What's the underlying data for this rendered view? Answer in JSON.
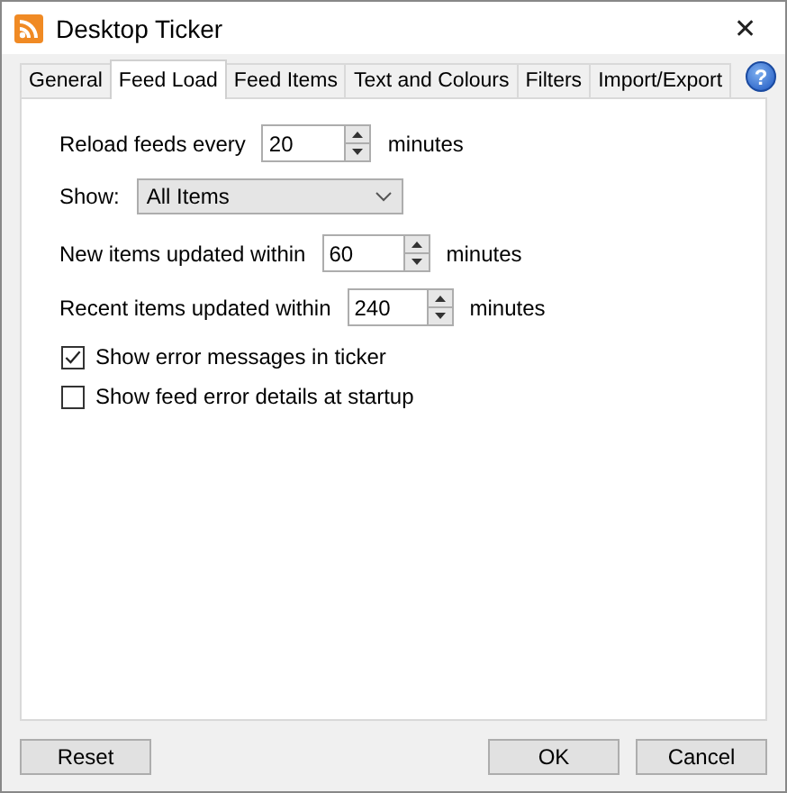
{
  "window": {
    "title": "Desktop Ticker",
    "close": "✕"
  },
  "tabs": [
    {
      "label": "General",
      "selected": false
    },
    {
      "label": "Feed Load",
      "selected": true
    },
    {
      "label": "Feed Items",
      "selected": false
    },
    {
      "label": "Text and Colours",
      "selected": false
    },
    {
      "label": "Filters",
      "selected": false
    },
    {
      "label": "Import/Export",
      "selected": false
    }
  ],
  "help": "?",
  "settings": [
    {
      "kind": "spinner",
      "label": "Reload feeds every",
      "value": "20",
      "unit": "minutes"
    },
    {
      "kind": "dropdown",
      "label": "Show:",
      "value": "All Items"
    },
    {
      "kind": "spinner",
      "label": "New items updated within",
      "value": "60",
      "unit": "minutes"
    },
    {
      "kind": "spinner",
      "label": "Recent items updated within",
      "value": "240",
      "unit": "minutes"
    },
    {
      "kind": "checkbox",
      "label": "Show error messages in ticker",
      "checked": true
    },
    {
      "kind": "checkbox",
      "label": "Show feed error details at startup",
      "checked": false
    }
  ],
  "buttons": {
    "left": [
      "Reset"
    ],
    "right": [
      "OK",
      "Cancel"
    ]
  }
}
